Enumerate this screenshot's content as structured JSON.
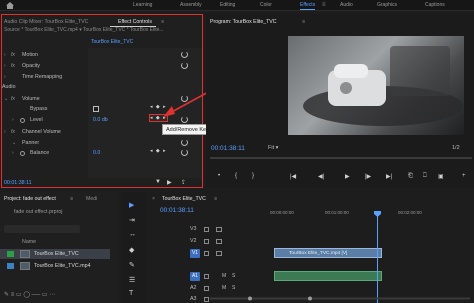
{
  "workspaces": [
    "Learning",
    "Assembly",
    "Editing",
    "Color",
    "Effects",
    "Audio",
    "Graphics",
    "Captions"
  ],
  "active_workspace": "Effects",
  "accent_color": "#5aa0ff",
  "highlight_color": "#e03131",
  "effect_panel": {
    "tabs": [
      "Audio Clip Mixer: TourBox Elite_TVC",
      "Effect Controls",
      "≡"
    ],
    "source_line": "Source * TourBox Elite_TVC.mp4 ▾    TourBox Elite_TVC * TourBox Elite...",
    "clip_label": "TourBox Elite_TVC",
    "video_effects": [
      {
        "fx": "fx",
        "label": "Motion"
      },
      {
        "fx": "fx",
        "label": "Opacity"
      },
      {
        "fx": "",
        "label": "Time Remapping"
      }
    ],
    "audio_section": "Audio",
    "volume": {
      "fx": "fx",
      "label": "Volume"
    },
    "bypass_label": "Bypass",
    "level_label": "Level",
    "level_value": "0.0 db",
    "channel_volume": {
      "fx": "fx",
      "label": "Channel Volume"
    },
    "panner_label": "Panner",
    "balance_label": "Balance",
    "balance_value": "0.0",
    "timecode": "00:01:38:11"
  },
  "tooltip": "Add/Remove Keyframe",
  "program_monitor": {
    "title": "Program: TourBox Elite_TVC",
    "menu": "≡",
    "timecode": "00:01:38:11",
    "fit": "Fit",
    "fit_arrow": "▾",
    "page": "1/2",
    "controls": [
      "•",
      "{",
      "}",
      "|◀",
      "◀|",
      "▶",
      "|▶",
      "▶|",
      "⎗",
      "⎕",
      "▣",
      "+"
    ]
  },
  "project_panel": {
    "tabs": [
      "Project: fade out effect",
      "≡",
      "Medi"
    ],
    "file": "fade out effect.prproj",
    "name_header": "Name",
    "items": [
      {
        "name": "TourBox Elite_TVC",
        "selected": true
      },
      {
        "name": "TourBox Elite_TVC.mp4",
        "selected": false
      }
    ]
  },
  "tools": [
    "▶",
    "⇥",
    "↔",
    "◆",
    "✎",
    "☰",
    "T"
  ],
  "timeline": {
    "tabs": [
      "×",
      "TourBox Elite_TVC",
      "≡"
    ],
    "timecode": "00:01:38:11",
    "ruler": [
      "00:00:00:00",
      "00:01:00:00",
      "00:02:00:00"
    ],
    "tracks": [
      {
        "name": "V3",
        "badge": ""
      },
      {
        "name": "V2",
        "badge": ""
      },
      {
        "name": "V1",
        "badge": "V1"
      },
      {
        "name": "A1",
        "badge": "A1"
      },
      {
        "name": "A2",
        "badge": ""
      },
      {
        "name": "A3",
        "badge": ""
      }
    ],
    "track_buttons": [
      "M",
      "S"
    ],
    "video_clip": "TourBox Elite_TVC.mp4 [V]"
  }
}
